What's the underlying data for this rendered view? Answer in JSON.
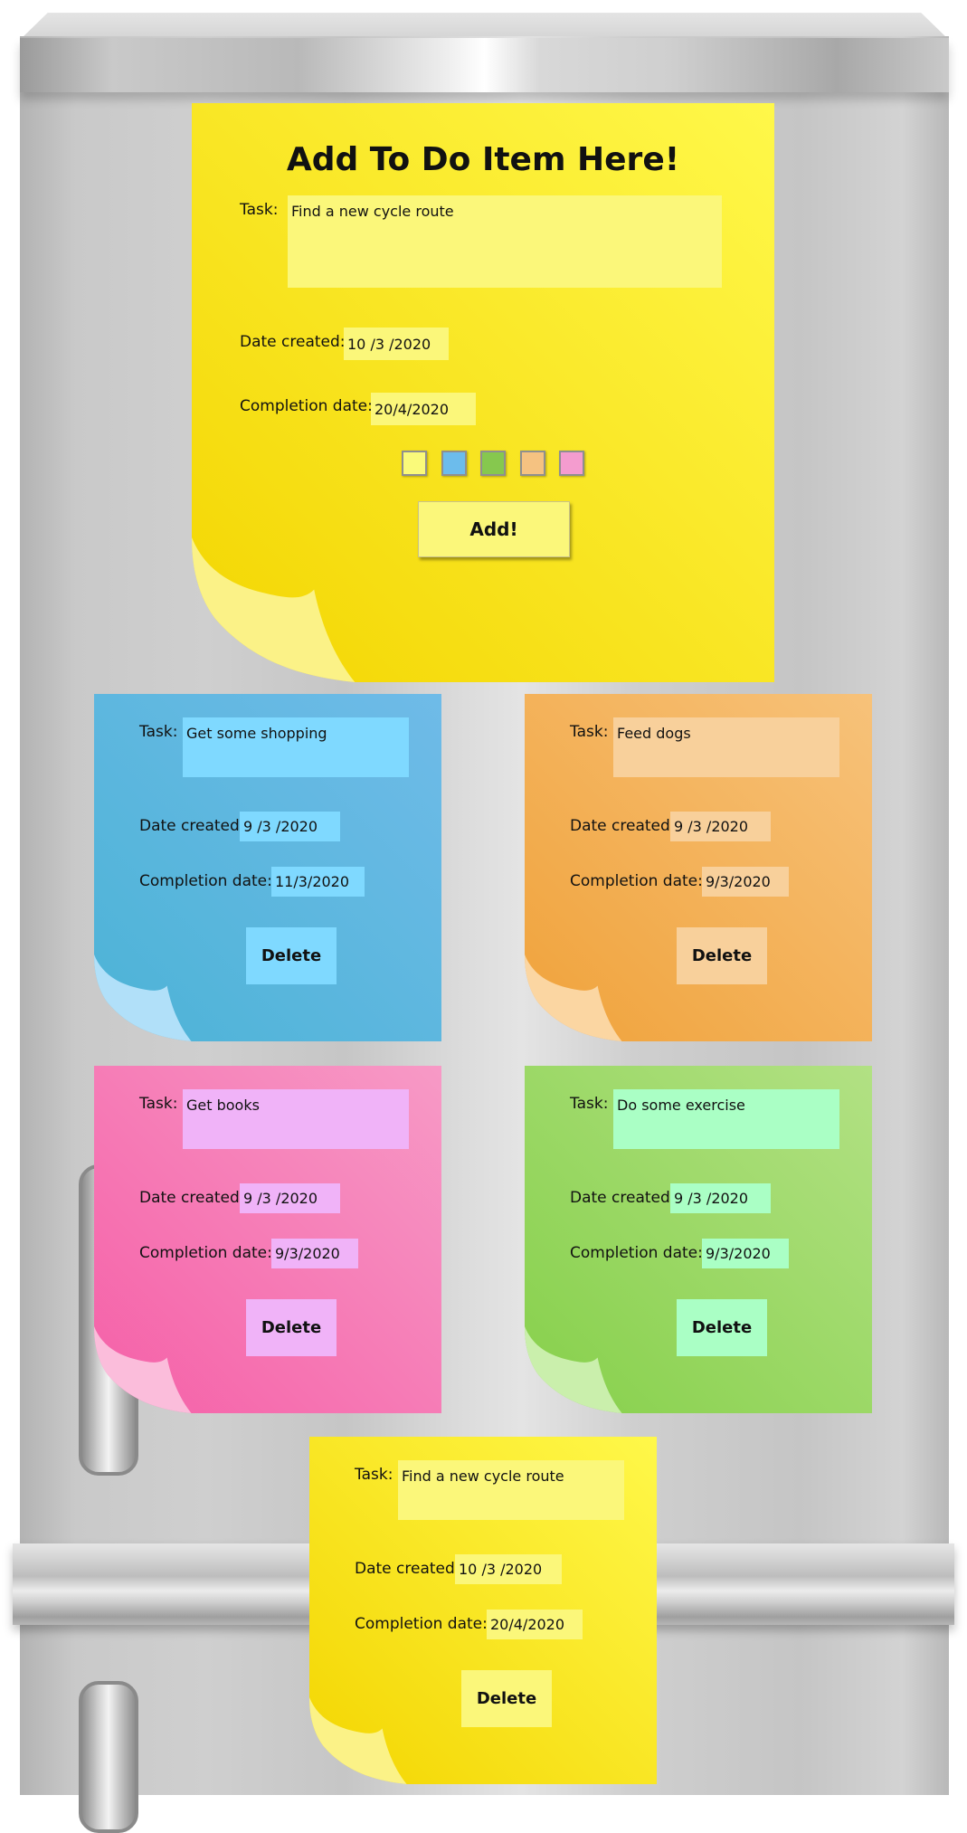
{
  "add_form": {
    "title": "Add To Do Item Here!",
    "task_label": "Task:",
    "task_value": "Find a new cycle route",
    "date_created_label": "Date created:",
    "date_created_value": "10 /3 /2020",
    "completion_label": "Completion date:",
    "completion_value": "20/4/2020",
    "color_options": [
      "#fafa7a",
      "#6cbcec",
      "#86c84e",
      "#f5c281",
      "#f49ccf"
    ],
    "add_button": "Add!"
  },
  "notes": [
    {
      "color": "blue",
      "task_label": "Task:",
      "task_value": "Get some shopping",
      "date_created_label": "Date created:",
      "date_created_value": "9 /3 /2020",
      "completion_label": "Completion date:",
      "completion_value": "11/3/2020",
      "delete_button": "Delete"
    },
    {
      "color": "orange",
      "task_label": "Task:",
      "task_value": "Feed dogs",
      "date_created_label": "Date created:",
      "date_created_value": "9 /3 /2020",
      "completion_label": "Completion date:",
      "completion_value": "9/3/2020",
      "delete_button": "Delete"
    },
    {
      "color": "pink",
      "task_label": "Task:",
      "task_value": "Get books",
      "date_created_label": "Date created:",
      "date_created_value": "9 /3 /2020",
      "completion_label": "Completion date:",
      "completion_value": "9/3/2020",
      "delete_button": "Delete"
    },
    {
      "color": "green",
      "task_label": "Task:",
      "task_value": "Do some exercise",
      "date_created_label": "Date created:",
      "date_created_value": "9 /3 /2020",
      "completion_label": "Completion date:",
      "completion_value": "9/3/2020",
      "delete_button": "Delete"
    },
    {
      "color": "yellow",
      "task_label": "Task:",
      "task_value": "Find a new cycle route",
      "date_created_label": "Date created:",
      "date_created_value": "10 /3 /2020",
      "completion_label": "Completion date:",
      "completion_value": "20/4/2020",
      "delete_button": "Delete"
    }
  ],
  "palette": {
    "yellow": {
      "light": "#fff84a",
      "dark": "#f3d500",
      "field": "#fbf77a",
      "curl": "#fbf38e"
    },
    "blue": {
      "light": "#6fbbe8",
      "dark": "#4cb3d6",
      "field": "#7fd9ff",
      "curl": "#b6e3fb"
    },
    "orange": {
      "light": "#f7c27a",
      "dark": "#f0a23a",
      "field": "#f8d09b",
      "curl": "#fbd8a8"
    },
    "pink": {
      "light": "#f79ac6",
      "dark": "#f55fa7",
      "field": "#f0b3f8",
      "curl": "#fbc2dd"
    },
    "green": {
      "light": "#b2e184",
      "dark": "#86d04a",
      "field": "#aaffc5",
      "curl": "#cdf0b1"
    }
  }
}
